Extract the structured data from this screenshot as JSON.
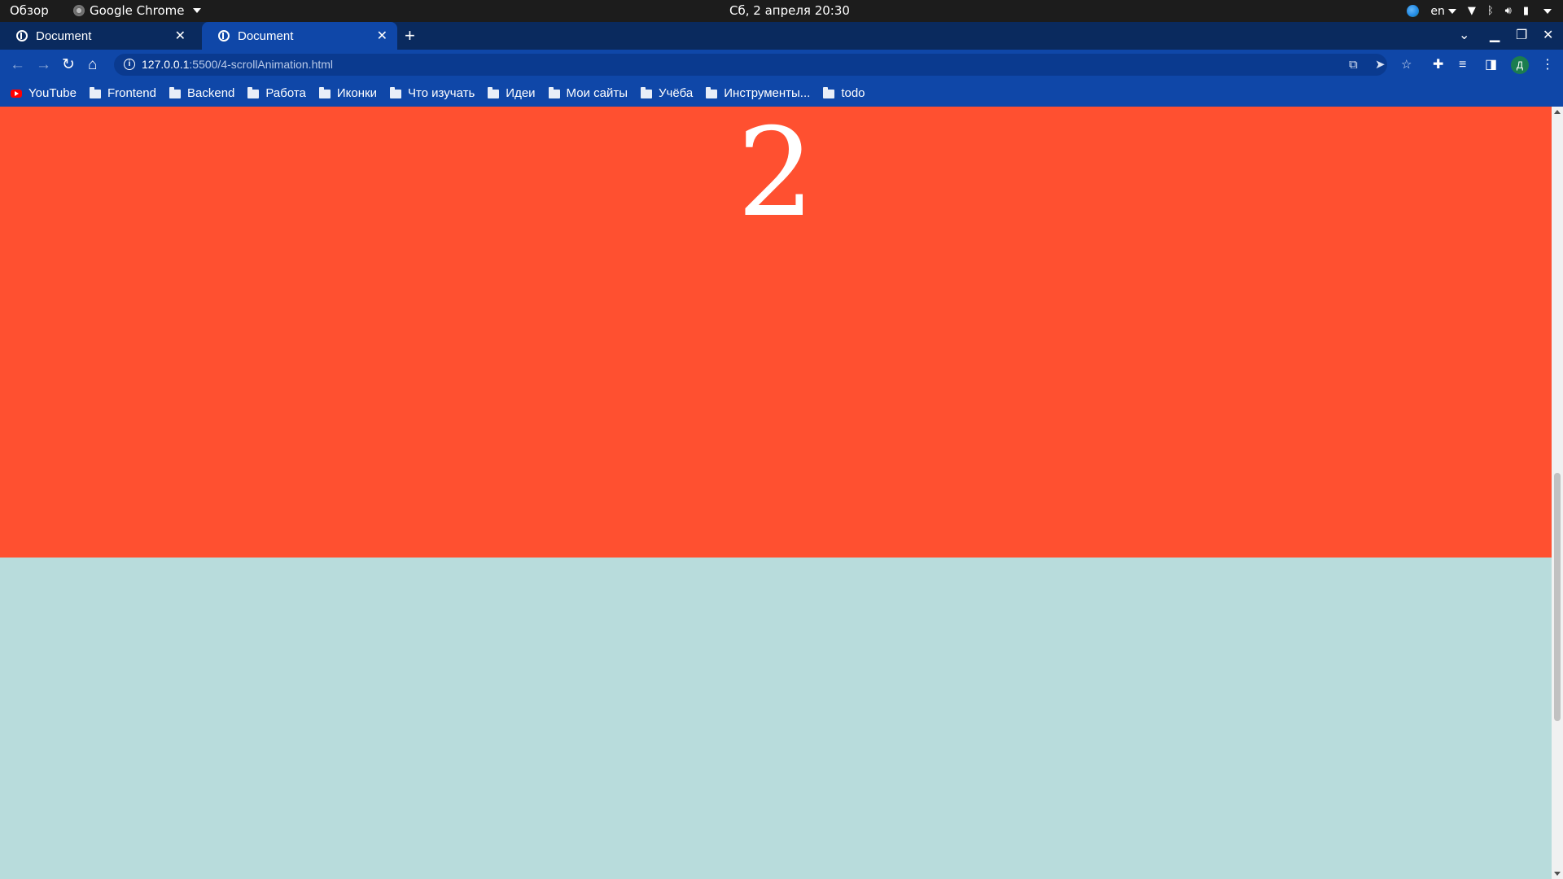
{
  "system_bar": {
    "overview_label": "Обзор",
    "app_name": "Google Chrome",
    "clock": "Сб, 2 апреля  20:30",
    "keyboard_layout": "en"
  },
  "tabs": [
    {
      "title": "Document",
      "active": false
    },
    {
      "title": "Document",
      "active": true
    }
  ],
  "address_bar": {
    "url_host": "127.0.0.1",
    "url_path": ":5500/4-scrollAnimation.html"
  },
  "profile": {
    "initial": "Д"
  },
  "bookmarks": [
    {
      "label": "YouTube",
      "icon": "youtube-icon"
    },
    {
      "label": "Frontend",
      "icon": "folder-icon"
    },
    {
      "label": "Backend",
      "icon": "folder-icon"
    },
    {
      "label": "Работа",
      "icon": "folder-icon"
    },
    {
      "label": "Иконки",
      "icon": "folder-icon"
    },
    {
      "label": "Что изучать",
      "icon": "folder-icon"
    },
    {
      "label": "Идеи",
      "icon": "folder-icon"
    },
    {
      "label": "Мои сайты",
      "icon": "folder-icon"
    },
    {
      "label": "Учёба",
      "icon": "folder-icon"
    },
    {
      "label": "Инструменты...",
      "icon": "folder-icon"
    },
    {
      "label": "todo",
      "icon": "folder-icon"
    }
  ],
  "page": {
    "section_number": "2",
    "colors": {
      "section_red": "#ff5030",
      "section_teal": "#b8dcdc",
      "chrome_blue": "#0f47a8"
    }
  }
}
